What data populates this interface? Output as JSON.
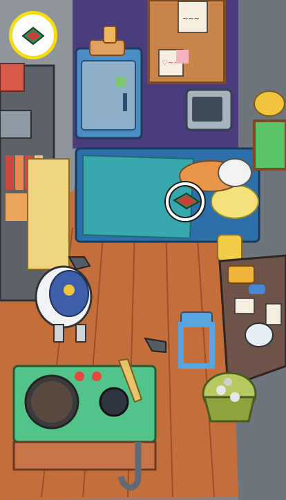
{
  "game": {
    "target_item": {
      "icon": "green-book-icon",
      "color": "#2e8b57",
      "accent": "#c9423a",
      "found": true
    },
    "colors": {
      "badge_ring": "#f7dc12",
      "floor": "#c9733f",
      "wall": "#8a8f96",
      "closet": "#4a3f7a",
      "blanket": "#2e9ea6"
    }
  },
  "scene": {
    "notes": {
      "poster_top": "~~~",
      "poster_mid": "♡~~",
      "pink_note": "≡≡"
    }
  }
}
